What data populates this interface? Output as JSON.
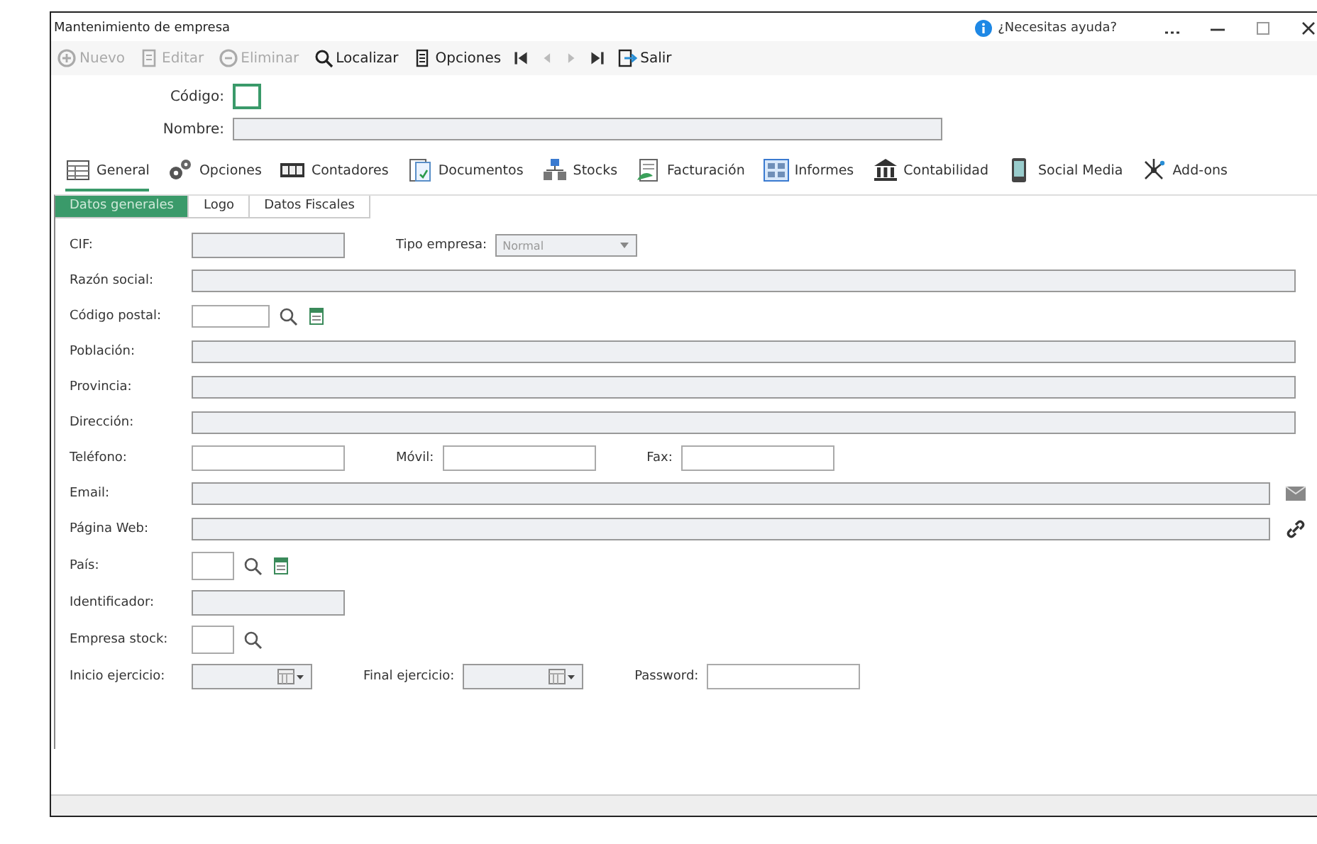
{
  "window": {
    "title": "Mantenimiento de empresa",
    "help": "¿Necesitas ayuda?"
  },
  "toolbar": [
    {
      "kind": "new",
      "label": "Nuevo",
      "disabled": true
    },
    {
      "kind": "edit",
      "label": "Editar",
      "disabled": true
    },
    {
      "kind": "delete",
      "label": "Eliminar",
      "disabled": true
    },
    {
      "kind": "search",
      "label": "Localizar",
      "disabled": false
    },
    {
      "kind": "options",
      "label": "Opciones",
      "disabled": false
    },
    {
      "kind": "first",
      "disabled": false
    },
    {
      "kind": "prev",
      "disabled": true
    },
    {
      "kind": "next",
      "disabled": true
    },
    {
      "kind": "last",
      "disabled": false
    },
    {
      "kind": "exit",
      "label": "Salir",
      "disabled": false
    }
  ],
  "header": [
    {
      "label": "Código:",
      "kind": "short",
      "focused": true,
      "disabled": false
    },
    {
      "label": "Nombre:",
      "kind": "long",
      "focused": false,
      "disabled": true
    }
  ],
  "main_tabs": [
    {
      "kind": "general",
      "label": "General",
      "selected": true
    },
    {
      "kind": "options",
      "label": "Opciones",
      "selected": false
    },
    {
      "kind": "counters",
      "label": "Contadores",
      "selected": false
    },
    {
      "kind": "documents",
      "label": "Documentos",
      "selected": false
    },
    {
      "kind": "stocks",
      "label": "Stocks",
      "selected": false
    },
    {
      "kind": "billing",
      "label": "Facturación",
      "selected": false
    },
    {
      "kind": "reports",
      "label": "Informes",
      "selected": false
    },
    {
      "kind": "accounting",
      "label": "Contabilidad",
      "selected": false
    },
    {
      "kind": "social",
      "label": "Social Media",
      "selected": false
    },
    {
      "kind": "addons",
      "label": "Add-ons",
      "selected": false
    }
  ],
  "sub_tabs": [
    {
      "label": "Datos generales",
      "selected": true
    },
    {
      "label": "Logo",
      "selected": false
    },
    {
      "label": "Datos Fiscales",
      "selected": false
    }
  ],
  "form_rows": [
    {
      "fields": [
        {
          "label": "CIF:",
          "kind": "medium",
          "disabled": true
        },
        {
          "label": "Tipo empresa:",
          "kind": "select",
          "disabled": true,
          "value": "Normal"
        }
      ]
    },
    {
      "fields": [
        {
          "label": "Razón social:",
          "kind": "long",
          "disabled": true
        }
      ]
    },
    {
      "fields": [
        {
          "label": "Código postal:",
          "kind": "code",
          "disabled": false,
          "search": true,
          "list": true
        }
      ]
    },
    {
      "fields": [
        {
          "label": "Población:",
          "kind": "long",
          "disabled": true
        }
      ]
    },
    {
      "fields": [
        {
          "label": "Provincia:",
          "kind": "long",
          "disabled": true
        }
      ]
    },
    {
      "fields": [
        {
          "label": "Dirección:",
          "kind": "long",
          "disabled": true
        }
      ]
    },
    {
      "fields": [
        {
          "label": "Teléfono:",
          "kind": "medium",
          "disabled": false
        },
        {
          "label": "Móvil:",
          "kind": "medium",
          "disabled": false
        },
        {
          "label": "Fax:",
          "kind": "medium",
          "disabled": false
        }
      ]
    },
    {
      "fields": [
        {
          "label": "Email:",
          "kind": "long",
          "disabled": true,
          "mail": true
        }
      ]
    },
    {
      "fields": [
        {
          "label": "Página Web:",
          "kind": "long",
          "disabled": true,
          "link": true
        }
      ]
    },
    {
      "fields": [
        {
          "label": "País:",
          "kind": "tiny",
          "disabled": false,
          "search": true,
          "list": true
        }
      ]
    },
    {
      "fields": [
        {
          "label": "Identificador:",
          "kind": "medium",
          "disabled": true
        }
      ]
    },
    {
      "fields": [
        {
          "label": "Empresa stock:",
          "kind": "tiny",
          "disabled": false,
          "search": true
        }
      ]
    },
    {
      "fields": [
        {
          "label": "Inicio ejercicio:",
          "kind": "date",
          "disabled": true
        },
        {
          "label": "Final ejercicio:",
          "kind": "date",
          "disabled": true
        },
        {
          "label": "Password:",
          "kind": "medium",
          "disabled": false
        }
      ]
    }
  ]
}
